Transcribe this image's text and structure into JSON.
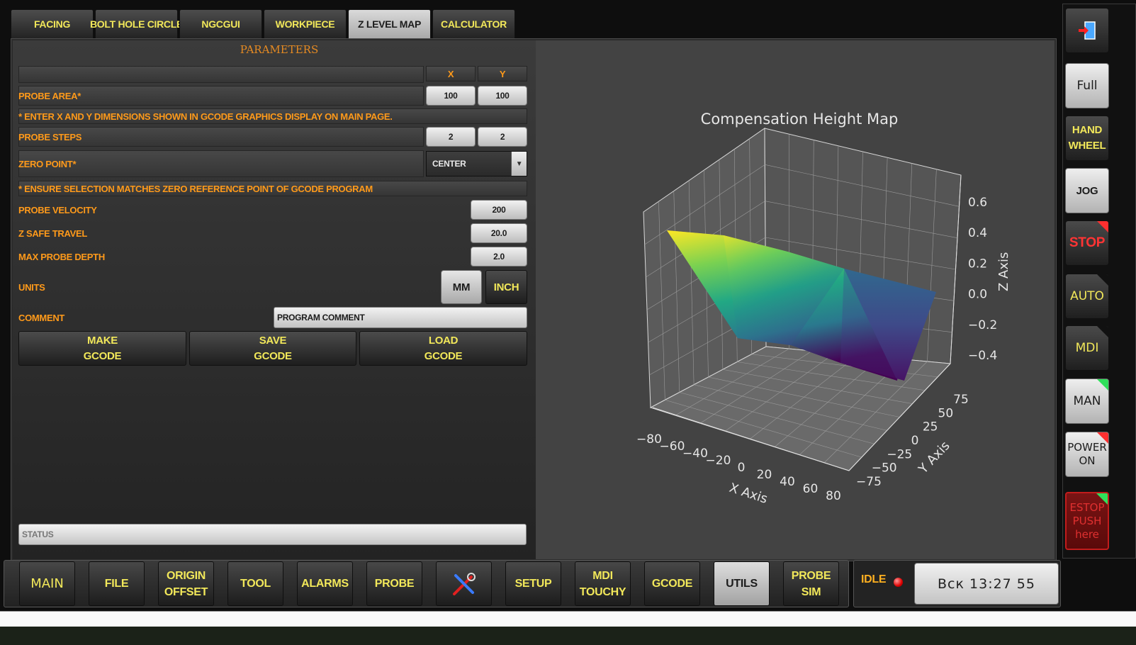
{
  "tabs": [
    {
      "label": "FACING"
    },
    {
      "label": "BOLT HOLE CIRCLE"
    },
    {
      "label": "NGCGUI"
    },
    {
      "label": "WORKPIECE"
    },
    {
      "label": "Z LEVEL MAP",
      "active": true
    },
    {
      "label": "CALCULATOR"
    }
  ],
  "params": {
    "title": "PARAMETERS",
    "x_header": "X",
    "y_header": "Y",
    "probe_area_label": "PROBE AREA*",
    "probe_area_x": "100",
    "probe_area_y": "100",
    "note_dimensions": "* ENTER X AND Y DIMENSIONS SHOWN IN GCODE GRAPHICS DISPLAY ON MAIN PAGE.",
    "probe_steps_label": "PROBE STEPS",
    "probe_steps_x": "2",
    "probe_steps_y": "2",
    "zero_point_label": "ZERO POINT*",
    "zero_point_value": "CENTER",
    "note_zero": "* ENSURE SELECTION MATCHES ZERO REFERENCE POINT OF GCODE PROGRAM",
    "probe_velocity_label": "PROBE VELOCITY",
    "probe_velocity": "200",
    "z_safe_label": "Z SAFE TRAVEL",
    "z_safe": "20.0",
    "max_depth_label": "MAX PROBE DEPTH",
    "max_depth": "2.0",
    "units_label": "UNITS",
    "units_mm": "MM",
    "units_inch": "INCH",
    "comment_label": "COMMENT",
    "comment_value": "PROGRAM COMMENT",
    "make_l1": "MAKE",
    "make_l2": "GCODE",
    "save_l1": "SAVE",
    "save_l2": "GCODE",
    "load_l1": "LOAD",
    "load_l2": "GCODE",
    "status_placeholder": "STATUS"
  },
  "chart_data": {
    "type": "surface3d",
    "title": "Compensation Height Map",
    "xlabel": "X Axis",
    "ylabel": "Y Axis",
    "zlabel": "Z Axis",
    "x": [
      -80,
      0,
      80
    ],
    "y": [
      -80,
      0,
      80
    ],
    "z": [
      [
        0.6,
        0.5,
        0.3
      ],
      [
        -0.3,
        -0.35,
        -0.4
      ],
      [
        -0.45,
        -0.3,
        0.1
      ]
    ],
    "xticks": [
      "−80",
      "−60",
      "−40",
      "−20",
      "0",
      "20",
      "40",
      "60",
      "80"
    ],
    "yticks": [
      "−75",
      "−50",
      "−25",
      "0",
      "25",
      "50",
      "75"
    ],
    "zticks": [
      "−0.4",
      "−0.2",
      "0.0",
      "0.2",
      "0.4",
      "0.6"
    ],
    "colormap": "viridis"
  },
  "right": {
    "full": "Full",
    "handwheel_l1": "HAND",
    "handwheel_l2": "WHEEL",
    "jog": "JOG",
    "stop": "STOP",
    "auto": "AUTO",
    "mdi": "MDI",
    "man": "MAN",
    "power_l1": "POWER",
    "power_l2": "ON",
    "estop_l1": "ESTOP",
    "estop_l2": "PUSH",
    "estop_l3": "here"
  },
  "nav": {
    "main": "MAIN",
    "file": "FILE",
    "origin_l1": "ORIGIN",
    "origin_l2": "OFFSET",
    "tool": "TOOL",
    "alarms": "ALARMS",
    "probe": "PROBE",
    "setup": "SETUP",
    "mdi_l1": "MDI",
    "mdi_l2": "TOUCHY",
    "gcode": "GCODE",
    "utils": "UTILS",
    "probesim_l1": "PROBE",
    "probesim_l2": "SIM"
  },
  "status": {
    "state": "IDLE",
    "clock": "Вск 13:27 55"
  }
}
